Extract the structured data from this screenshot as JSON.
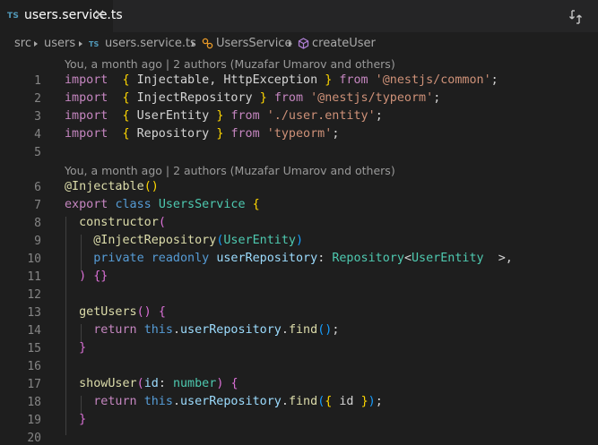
{
  "tab": {
    "lang_badge": "TS",
    "filename": "users.service.ts",
    "close_glyph": "×"
  },
  "toolbar": {
    "compare_icon": "open-changes-icon"
  },
  "breadcrumb": {
    "segments": [
      "src",
      "users",
      "users.service.ts",
      "UsersService",
      "createUser"
    ],
    "file_badge": "TS"
  },
  "codelens": {
    "line1": "You, a month ago | 2 authors (Muzafar Umarov and others)",
    "line2": "You, a month ago | 2 authors (Muzafar Umarov and others)"
  },
  "code": {
    "l1": [
      [
        "kw2",
        "import"
      ],
      [
        "",
        "  "
      ],
      [
        "b1",
        "{"
      ],
      [
        "",
        " Injectable, HttpException "
      ],
      [
        "b1",
        "}"
      ],
      [
        "",
        " "
      ],
      [
        "kw2",
        "from"
      ],
      [
        "",
        " "
      ],
      [
        "str",
        "'@nestjs/common'"
      ],
      [
        "",
        ";"
      ]
    ],
    "l2": [
      [
        "kw2",
        "import"
      ],
      [
        "",
        "  "
      ],
      [
        "b1",
        "{"
      ],
      [
        "",
        " InjectRepository "
      ],
      [
        "b1",
        "}"
      ],
      [
        "",
        " "
      ],
      [
        "kw2",
        "from"
      ],
      [
        "",
        " "
      ],
      [
        "str",
        "'@nestjs/typeorm'"
      ],
      [
        "",
        ";"
      ]
    ],
    "l3": [
      [
        "kw2",
        "import"
      ],
      [
        "",
        "  "
      ],
      [
        "b1",
        "{"
      ],
      [
        "",
        " UserEntity "
      ],
      [
        "b1",
        "}"
      ],
      [
        "",
        " "
      ],
      [
        "kw2",
        "from"
      ],
      [
        "",
        " "
      ],
      [
        "str",
        "'./user.entity'"
      ],
      [
        "",
        ";"
      ]
    ],
    "l4": [
      [
        "kw2",
        "import"
      ],
      [
        "",
        "  "
      ],
      [
        "b1",
        "{"
      ],
      [
        "",
        " Repository "
      ],
      [
        "b1",
        "}"
      ],
      [
        "",
        " "
      ],
      [
        "kw2",
        "from"
      ],
      [
        "",
        " "
      ],
      [
        "str",
        "'typeorm'"
      ],
      [
        "",
        ";"
      ]
    ],
    "l5": [],
    "l6": [
      [
        "dec",
        "@Injectable"
      ],
      [
        "b1",
        "()"
      ]
    ],
    "l7": [
      [
        "kw2",
        "export"
      ],
      [
        "",
        " "
      ],
      [
        "kw",
        "class"
      ],
      [
        "",
        " "
      ],
      [
        "cls",
        "UsersService"
      ],
      [
        "",
        " "
      ],
      [
        "b1",
        "{"
      ]
    ],
    "l8": [
      [
        "",
        "  "
      ],
      [
        "fn",
        "constructor"
      ],
      [
        "b2",
        "("
      ]
    ],
    "l9": [
      [
        "",
        "    "
      ],
      [
        "dec",
        "@InjectRepository"
      ],
      [
        "b3",
        "("
      ],
      [
        "cls",
        "UserEntity"
      ],
      [
        "b3",
        ")"
      ]
    ],
    "l10": [
      [
        "",
        "    "
      ],
      [
        "kw",
        "private"
      ],
      [
        "",
        " "
      ],
      [
        "kw",
        "readonly"
      ],
      [
        "",
        " "
      ],
      [
        "var",
        "userRepository"
      ],
      [
        "",
        ": "
      ],
      [
        "cls",
        "Repository"
      ],
      [
        "",
        "<"
      ],
      [
        "cls",
        "UserEntity"
      ],
      [
        "",
        "  >,"
      ]
    ],
    "l11": [
      [
        "",
        "  "
      ],
      [
        "b2",
        ")"
      ],
      [
        "",
        " "
      ],
      [
        "b2",
        "{}"
      ]
    ],
    "l12": [],
    "l13": [
      [
        "",
        "  "
      ],
      [
        "fn",
        "getUsers"
      ],
      [
        "b2",
        "()"
      ],
      [
        "",
        " "
      ],
      [
        "b2",
        "{"
      ]
    ],
    "l14": [
      [
        "",
        "    "
      ],
      [
        "kw2",
        "return"
      ],
      [
        "",
        " "
      ],
      [
        "kw",
        "this"
      ],
      [
        "",
        "."
      ],
      [
        "var",
        "userRepository"
      ],
      [
        "",
        "."
      ],
      [
        "fn",
        "find"
      ],
      [
        "b3",
        "()"
      ],
      [
        "",
        ";"
      ]
    ],
    "l15": [
      [
        "",
        "  "
      ],
      [
        "b2",
        "}"
      ]
    ],
    "l16": [],
    "l17": [
      [
        "",
        "  "
      ],
      [
        "fn",
        "showUser"
      ],
      [
        "b2",
        "("
      ],
      [
        "var",
        "id"
      ],
      [
        "",
        ": "
      ],
      [
        "cls",
        "number"
      ],
      [
        "b2",
        ")"
      ],
      [
        "",
        " "
      ],
      [
        "b2",
        "{"
      ]
    ],
    "l18": [
      [
        "",
        "    "
      ],
      [
        "kw2",
        "return"
      ],
      [
        "",
        " "
      ],
      [
        "kw",
        "this"
      ],
      [
        "",
        "."
      ],
      [
        "var",
        "userRepository"
      ],
      [
        "",
        "."
      ],
      [
        "fn",
        "find"
      ],
      [
        "b3",
        "("
      ],
      [
        "b1",
        "{"
      ],
      [
        "",
        " id "
      ],
      [
        "b1",
        "}"
      ],
      [
        "b3",
        ")"
      ],
      [
        "",
        ";"
      ]
    ],
    "l19": [
      [
        "",
        "  "
      ],
      [
        "b2",
        "}"
      ]
    ],
    "l20": []
  },
  "line_numbers": [
    "1",
    "2",
    "3",
    "4",
    "5",
    "6",
    "7",
    "8",
    "9",
    "10",
    "11",
    "12",
    "13",
    "14",
    "15",
    "16",
    "17",
    "18",
    "19",
    "20"
  ]
}
